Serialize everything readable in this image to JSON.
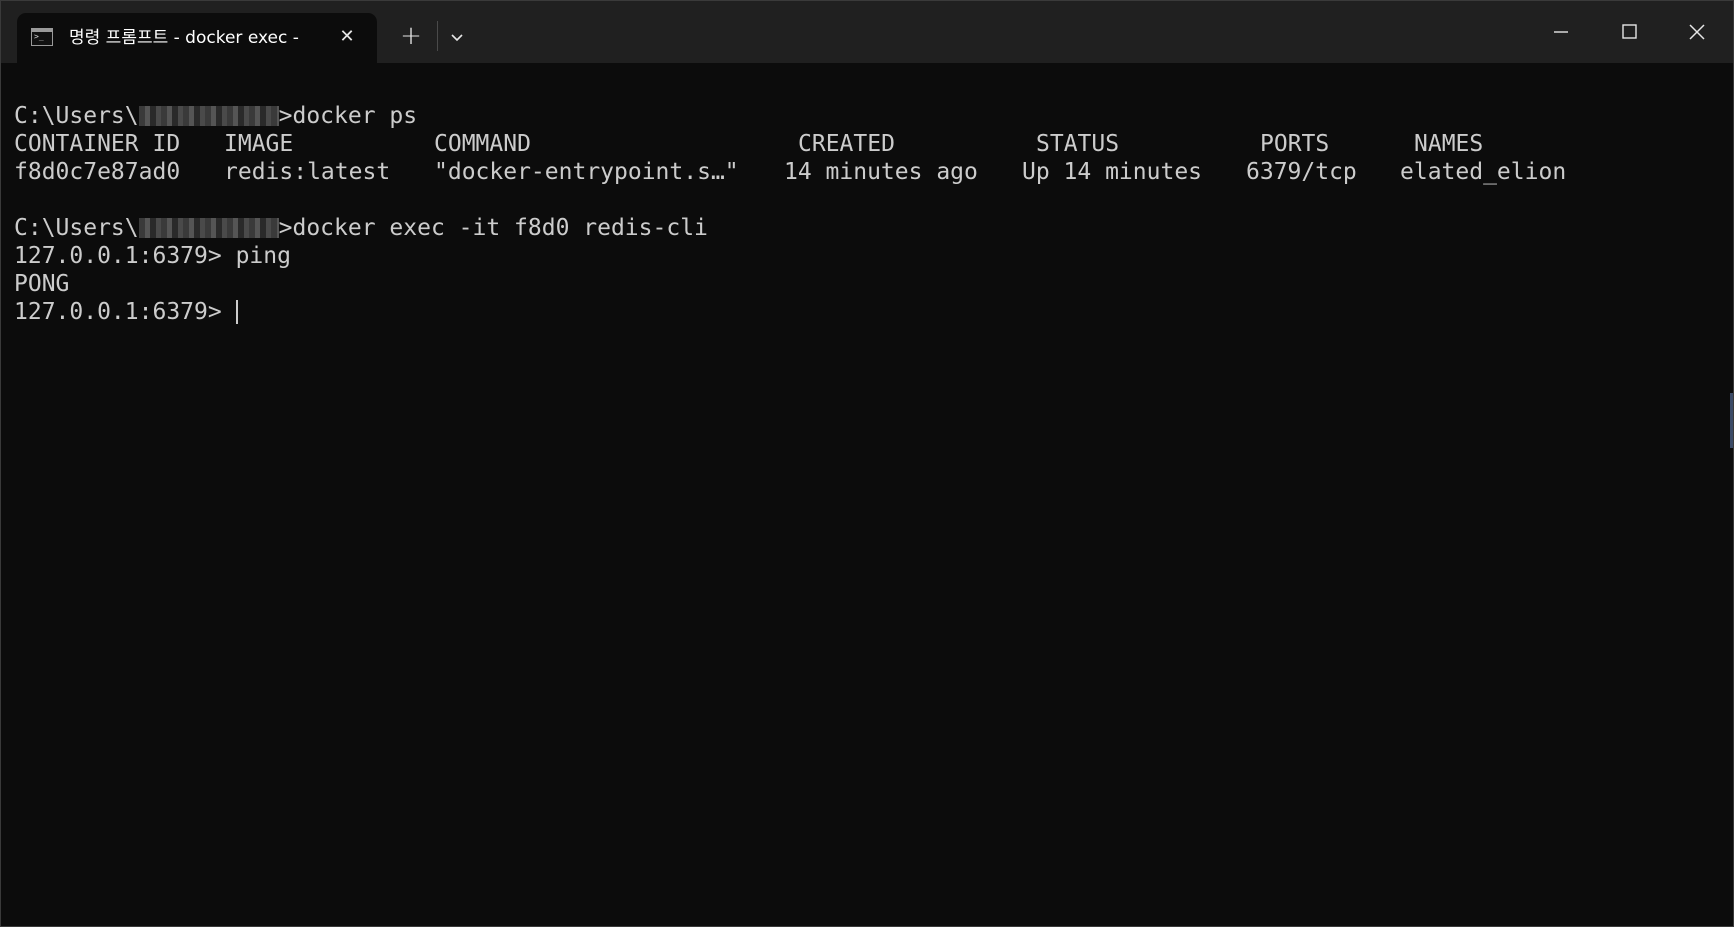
{
  "window": {
    "tab_title": "명령 프롬프트 - docker  exec -",
    "tab_close_symbol": "✕",
    "new_tab_symbol": "+",
    "icons": {
      "tab_icon": "command-prompt-icon",
      "dropdown": "chevron-down-icon",
      "minimize": "minimize-icon",
      "maximize": "maximize-icon",
      "close": "close-icon"
    }
  },
  "terminal": {
    "prompt_prefix": "C:\\Users\\",
    "cmd1": ">docker ps",
    "ps_table": {
      "headers": [
        "CONTAINER ID",
        "IMAGE",
        "COMMAND",
        "CREATED",
        "STATUS",
        "PORTS",
        "NAMES"
      ],
      "rows": [
        [
          "f8d0c7e87ad0",
          "redis:latest",
          "\"docker-entrypoint.s…\"",
          "14 minutes ago",
          "Up 14 minutes",
          "6379/tcp",
          "elated_elion"
        ]
      ]
    },
    "cmd2": ">docker exec -it f8d0 redis-cli",
    "redis_prompt": "127.0.0.1:6379> ",
    "redis_cmd": "ping",
    "redis_reply": "PONG",
    "text_color": "#cccccc",
    "background_color": "#0c0c0c"
  }
}
